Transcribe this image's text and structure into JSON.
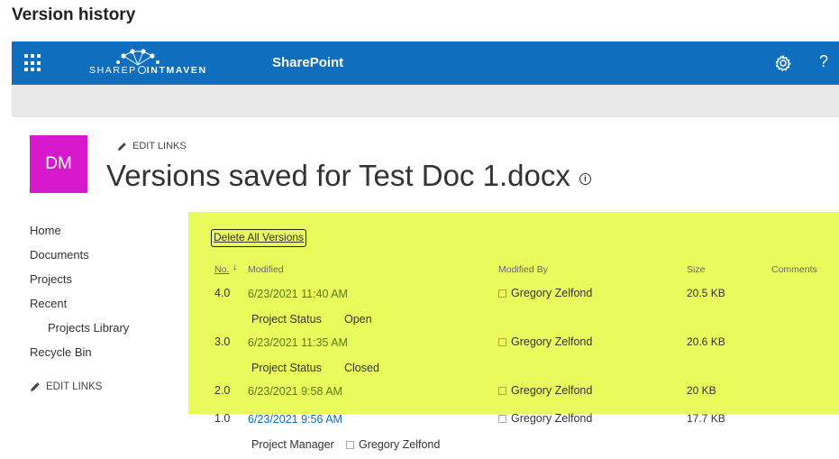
{
  "dialog_title": "Version history",
  "suitebar": {
    "brand_left": "SHAREP",
    "brand_right": "INTMAVEN",
    "app_name": "SharePoint",
    "help_label": "?"
  },
  "site": {
    "logo_initials": "DM",
    "logo_color": "#d719cd",
    "edit_links": "EDIT LINKS",
    "page_title": "Versions saved for Test Doc 1.docx",
    "info_glyph": "i"
  },
  "nav": {
    "items": [
      "Home",
      "Documents",
      "Projects",
      "Recent",
      "Projects Library",
      "Recycle Bin"
    ],
    "edit_links": "EDIT LINKS"
  },
  "highlight_color": "#e9fb5c",
  "delete_all_label": "Delete All Versions",
  "columns": {
    "no": "No.",
    "modified": "Modified",
    "modified_by": "Modified By",
    "size": "Size",
    "comments": "Comments"
  },
  "versions": [
    {
      "no": "4.0",
      "modified": "6/23/2021 11:40 AM",
      "modified_by": "Gregory Zelfond",
      "size": "20.5 KB",
      "field_name": "Project Status",
      "field_value": "Open"
    },
    {
      "no": "3.0",
      "modified": "6/23/2021 11:35 AM",
      "modified_by": "Gregory Zelfond",
      "size": "20.6 KB",
      "field_name": "Project Status",
      "field_value": "Closed"
    },
    {
      "no": "2.0",
      "modified": "6/23/2021 9:58 AM",
      "modified_by": "Gregory Zelfond",
      "size": "20 KB"
    },
    {
      "no": "1.0",
      "modified": "6/23/2021 9:56 AM",
      "modified_by": "Gregory Zelfond",
      "size": "17.7 KB",
      "field_name": "Project Manager",
      "field_value": "Gregory Zelfond"
    }
  ]
}
